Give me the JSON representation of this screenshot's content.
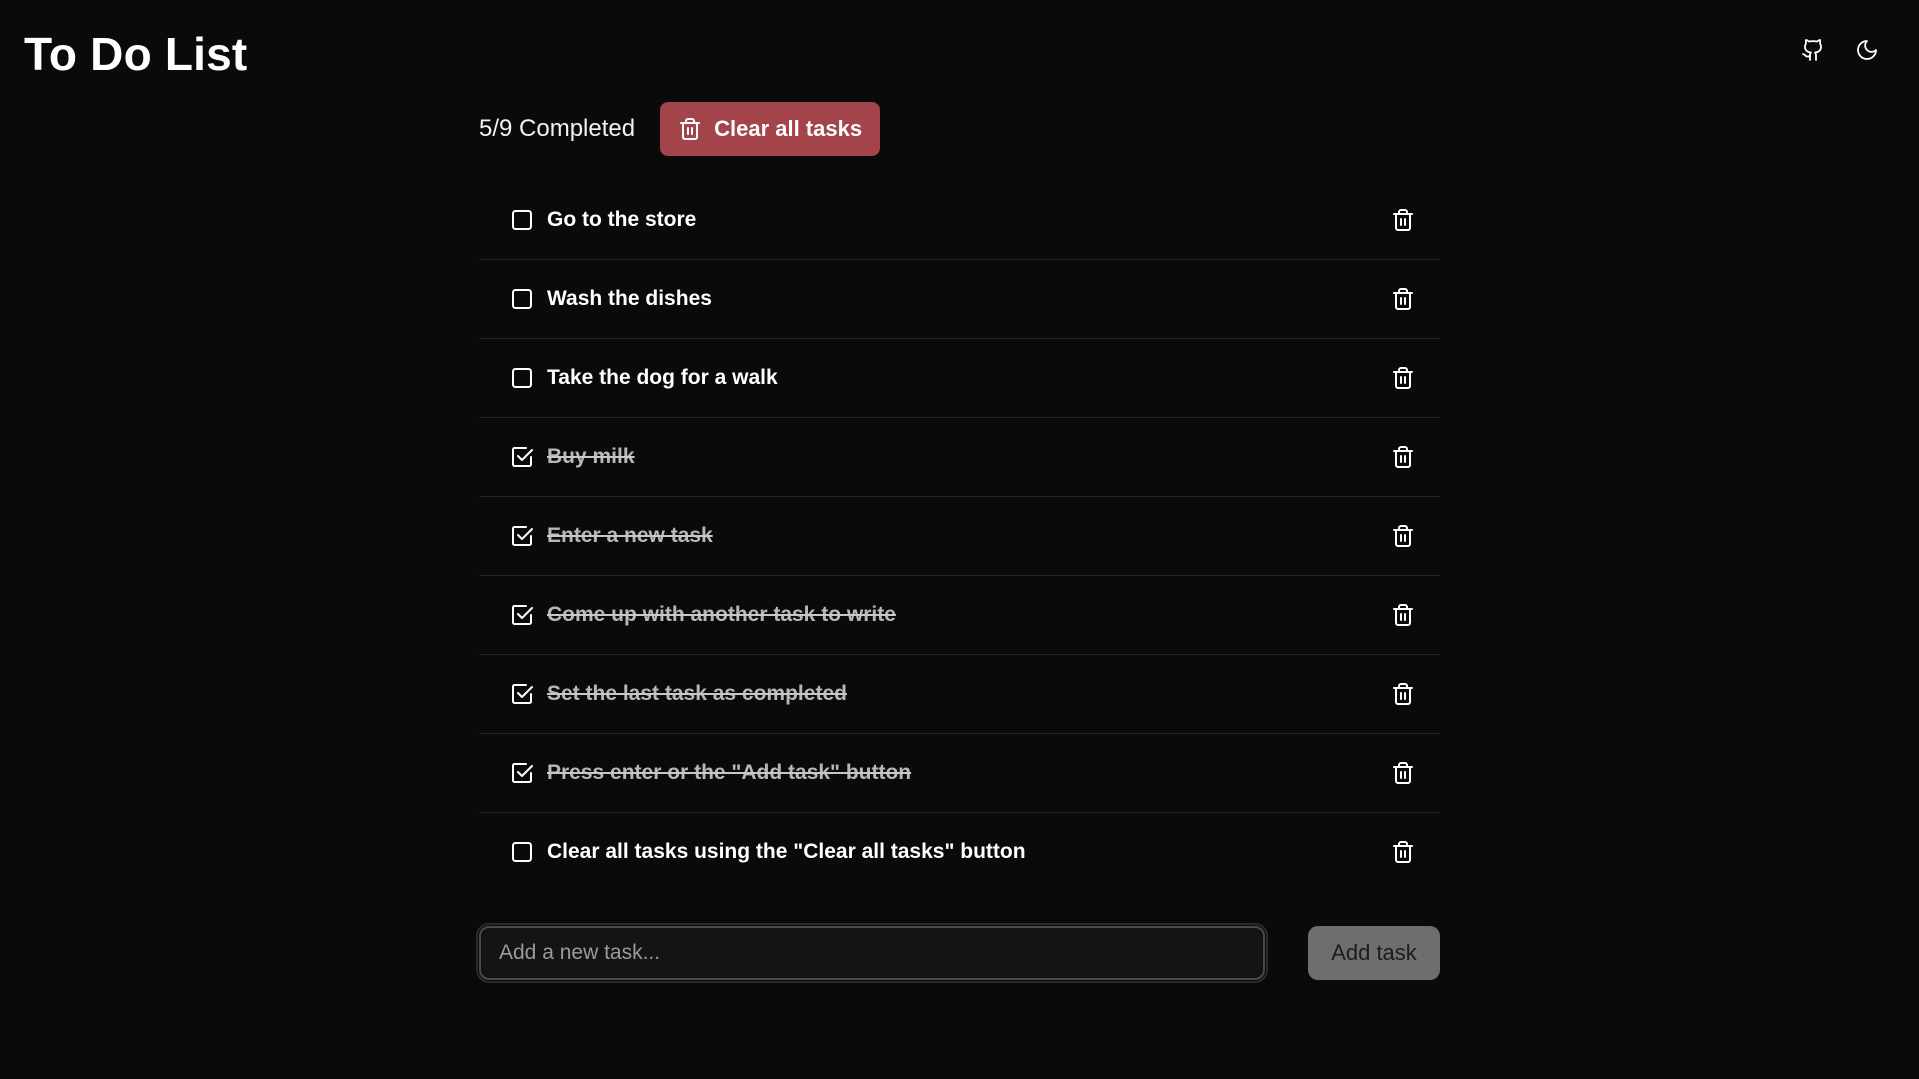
{
  "header": {
    "title": "To Do List",
    "github_icon": "github-icon",
    "theme_icon": "moon-icon"
  },
  "summary": {
    "completed_text": "5/9 Completed",
    "clear_all_label": "Clear all tasks",
    "clear_all_icon": "trash-icon"
  },
  "tasks": [
    {
      "label": "Go to the store",
      "completed": false
    },
    {
      "label": "Wash the dishes",
      "completed": false
    },
    {
      "label": "Take the dog for a walk",
      "completed": false
    },
    {
      "label": "Buy milk",
      "completed": true
    },
    {
      "label": "Enter a new task",
      "completed": true
    },
    {
      "label": "Come up with another task to write",
      "completed": true
    },
    {
      "label": "Set the last task as completed",
      "completed": true
    },
    {
      "label": "Press enter or the \"Add task\" button",
      "completed": true
    },
    {
      "label": "Clear all tasks using the \"Clear all tasks\" button",
      "completed": false
    }
  ],
  "new_task": {
    "placeholder": "Add a new task...",
    "value": "",
    "add_label": "Add task"
  },
  "colors": {
    "background": "#0a0a0a",
    "danger": "#a3434a",
    "muted_button": "#6e6e6e",
    "divider": "#262626"
  }
}
